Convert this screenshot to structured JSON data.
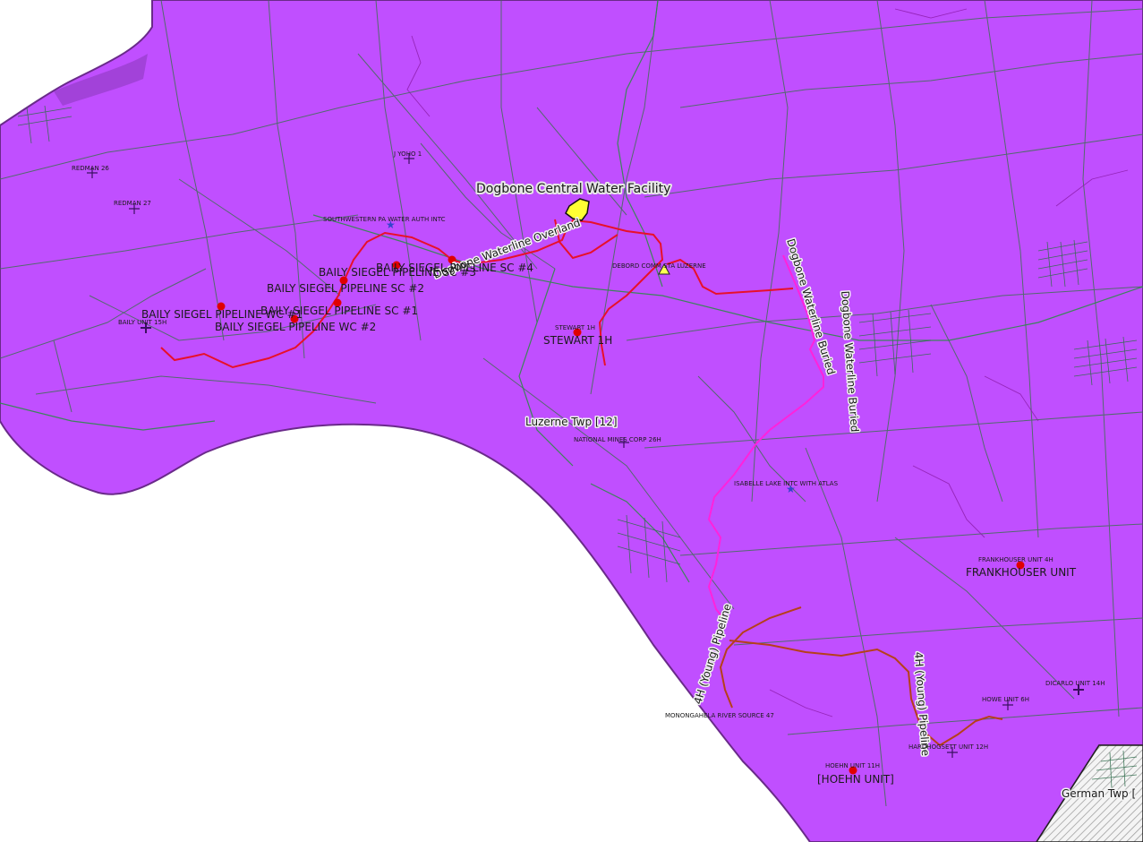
{
  "colors": {
    "land": "#c04fff",
    "water": "#ffffff",
    "parcel_lines": "#3f6f55",
    "township_boundary": "#6a2a8a",
    "overland_pipeline": "#e8102a",
    "buried_pipeline": "#ff22dd",
    "young_pipeline": "#b6401a",
    "well_marker": "#e00000",
    "facility_fill": "#ffff33",
    "roads": "#2f8a4a"
  },
  "facility": {
    "label": "Dogbone Central Water Facility",
    "icon": "water-facility-polygon"
  },
  "pipelines": {
    "overland": "Dogbone Waterline Overland",
    "buried_1": "Dogbone Waterline Buried",
    "buried_2": "Dogbone Waterline Buried",
    "young_1": "4H (Young) Pipeline",
    "young_2": "4H (Young) Pipeline"
  },
  "areas": {
    "luzerne": "Luzerne Twp [12]",
    "german": "German Twp ["
  },
  "wells": {
    "redman_26": "REDMAN 26",
    "redman_27": "REDMAN 27",
    "j_yoho_1": "J YOHO 1",
    "baily_unit_15h": "BAILY UNIT 15H",
    "southwestern_pa": "SOUTHWESTERN PA WATER AUTH INTC",
    "debord": "DEBORD COMM STA LUZERNE",
    "stewart_1h_small": "STEWART 1H",
    "national_mines": "NATIONAL MINES CORP 26H",
    "isabelle_lake": "ISABELLE LAKE INTC WITH ATLAS",
    "frankhouser_4h": "FRANKHOUSER UNIT 4H",
    "monongahela": "MONONGAHELA RIVER SOURCE 47",
    "hoehn_11h": "HOEHN UNIT 11H",
    "howe_6h": "HOWE UNIT 6H",
    "dicarlo_14h": "DICARLO UNIT 14H",
    "hardhogsett_12h": "HARDHOGSETT UNIT 12H"
  },
  "withdrawal_points": {
    "baily_sc4": "BAILY SIEGEL PIPELINE SC #4",
    "baily_sc3": "BAILY SIEGEL PIPELINE SC #3",
    "baily_sc2": "BAILY SIEGEL PIPELINE SC #2",
    "baily_sc1": "BAILY SIEGEL PIPELINE SC #1",
    "baily_wc1": "BAILY SIEGEL PIPELINE WC #1",
    "baily_wc2": "BAILY SIEGEL PIPELINE WC #2",
    "stewart_1h": "STEWART 1H",
    "frankhouser_unit": "FRANKHOUSER UNIT",
    "hoehn_unit": "[HOEHN UNIT]"
  }
}
